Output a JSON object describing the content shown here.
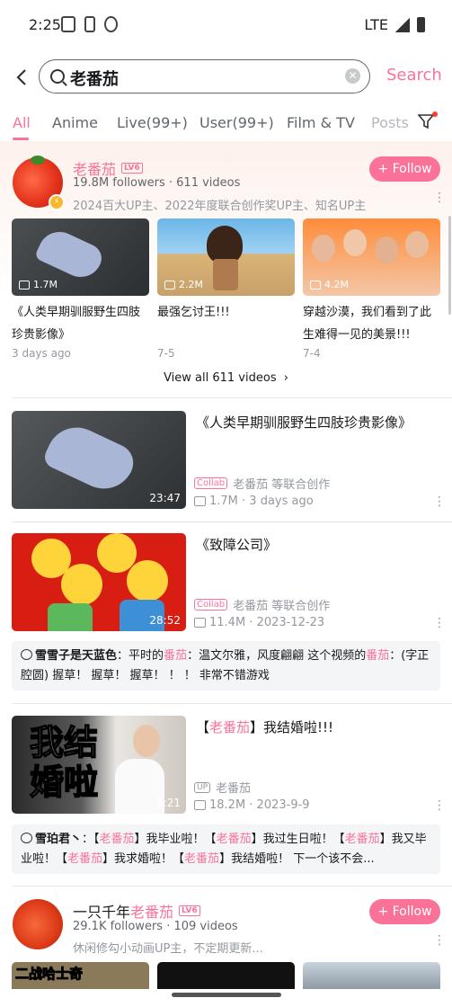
{
  "status_bar": {
    "time": "2:25",
    "network": "LTE"
  },
  "search": {
    "query": "老番茄",
    "button_label": "Search"
  },
  "tabs": [
    "All",
    "Anime",
    "Live(99+)",
    "User(99+)",
    "Film & TV",
    "Posts"
  ],
  "user_card": {
    "name": "老番茄",
    "level": "LV6",
    "stats": "19.8M followers · 611 videos",
    "description": "2024百大UP主、2022年度联合创作奖UP主、知名UP主",
    "follow_label": "+ Follow",
    "videos": [
      {
        "views": "1.7M",
        "title": "《人类早期驯服野生四肢珍贵影像》",
        "date": "3 days ago"
      },
      {
        "views": "2.2M",
        "title": "最强乞讨王!!!",
        "date": "7-5"
      },
      {
        "views": "4.2M",
        "title": "穿越沙漠，我们看到了此生难得一见的美景!!!",
        "date": "7-4"
      }
    ],
    "view_all": "View all 611 videos"
  },
  "results": [
    {
      "title": "《人类早期驯服野生四肢珍贵影像》",
      "duration": "23:47",
      "tag": "Collab",
      "author": "老番茄 等联合创作",
      "stats": "1.7M · 3 days ago"
    },
    {
      "title": "《致障公司》",
      "duration": "28:52",
      "tag": "Collab",
      "author": "老番茄 等联合创作",
      "stats": "11.4M · 2023-12-23",
      "comment": {
        "user": "雪雪子是天蓝色",
        "pre": "平时的",
        "k1": "番茄",
        "mid": "：温文尔雅，风度翩翩 这个视频的",
        "k2": "番茄",
        "post": "：(字正腔圆) 握草！ 握草！ 握草！ ！ ！ 非常不错游戏"
      }
    },
    {
      "title_pre": "【",
      "title_key": "老番茄",
      "title_post": "】我结婚啦!!!",
      "thumb_text": "我结 婚啦",
      "duration": "8:21",
      "tag": "UP",
      "author": "老番茄",
      "stats": "18.2M · 2023-9-9",
      "comment": {
        "user": "雪珀君丶",
        "k": "老番茄",
        "p1": "】我毕业啦！【",
        "p2": "】我过生日啦！【",
        "p3": "】我又毕业啦！【",
        "p4": "】我求婚啦！【",
        "p5": "】我结婚啦！ 下一个该不会..."
      }
    }
  ],
  "second_user": {
    "name_pre": "一只千年",
    "name_key": "老番茄",
    "level": "LV6",
    "stats": "29.1K followers · 109 videos",
    "description": "休闲修勾小动画UP主，不定期更新...",
    "follow_label": "+ Follow",
    "thumb_text": "二战哈士奇"
  }
}
